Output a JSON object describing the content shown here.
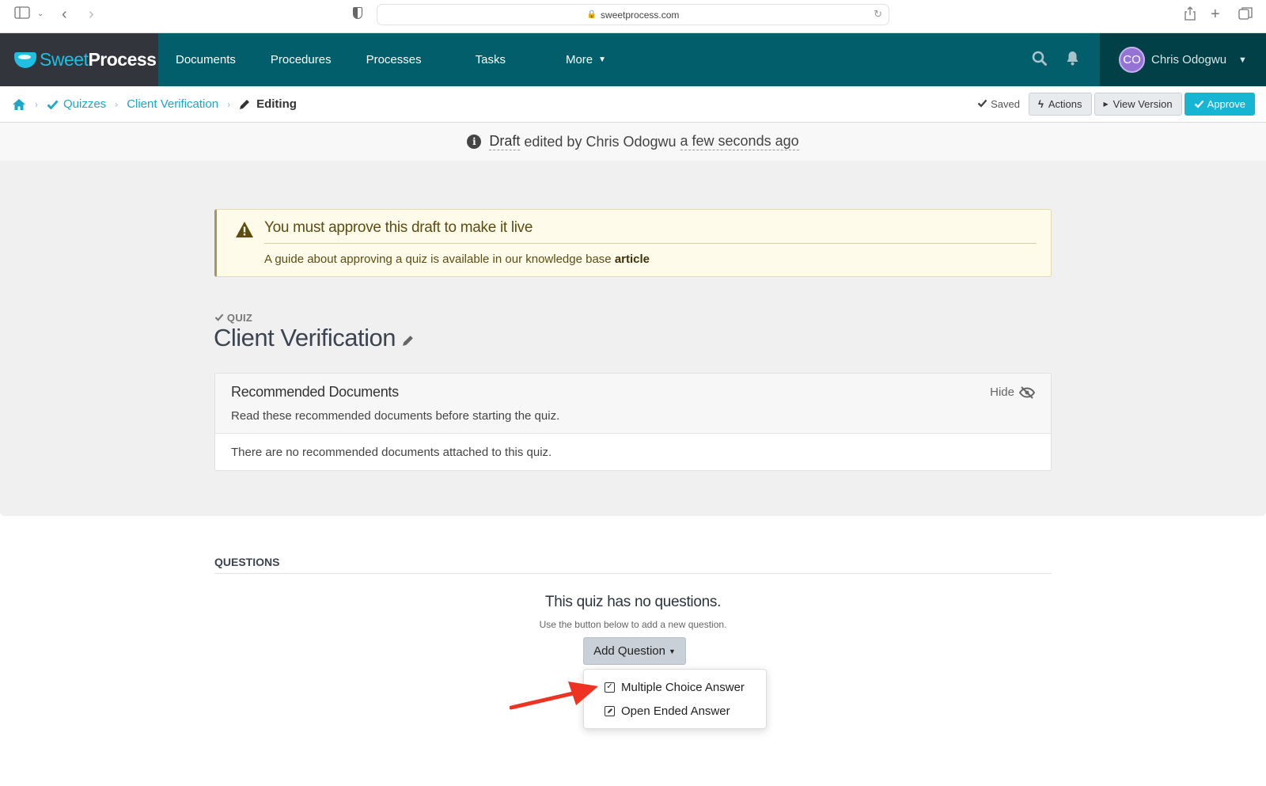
{
  "browser": {
    "url": "sweetprocess.com"
  },
  "nav": {
    "logo_sweet": "Sweet",
    "logo_process": "Process",
    "items": [
      {
        "label": "Documents"
      },
      {
        "label": "Procedures"
      },
      {
        "label": "Processes"
      },
      {
        "label": "Tasks"
      },
      {
        "label": "More"
      }
    ],
    "user": {
      "initials": "CO",
      "name": "Chris Odogwu"
    }
  },
  "breadcrumb": {
    "items": [
      {
        "label": "Quizzes"
      },
      {
        "label": "Client Verification"
      }
    ],
    "current": "Editing"
  },
  "toolbar": {
    "saved": "Saved",
    "actions": "Actions",
    "view_version": "View Version",
    "approve": "Approve"
  },
  "draft": {
    "status": "Draft",
    "edited_by": "edited by Chris Odogwu",
    "time": "a few seconds ago"
  },
  "alert": {
    "title": "You must approve this draft to make it live",
    "body": "A guide about approving a quiz is available in our knowledge base",
    "link": "article"
  },
  "document": {
    "kind": "QUIZ",
    "title": "Client Verification"
  },
  "recommended": {
    "title": "Recommended Documents",
    "subtitle": "Read these recommended documents before starting the quiz.",
    "hide": "Hide",
    "empty": "There are no recommended documents attached to this quiz."
  },
  "questions": {
    "heading": "QUESTIONS",
    "empty_title": "This quiz has no questions.",
    "empty_sub": "Use the button below to add a new question.",
    "add_button": "Add Question",
    "menu": [
      {
        "label": "Multiple Choice Answer",
        "icon": "checkbox-icon"
      },
      {
        "label": "Open Ended Answer",
        "icon": "edit-box-icon"
      }
    ]
  },
  "colors": {
    "nav": "#015e6a",
    "logo_bg": "#32363c",
    "user_bg": "#024048",
    "accent": "#17b5d4",
    "arrow": "#ee3322"
  }
}
